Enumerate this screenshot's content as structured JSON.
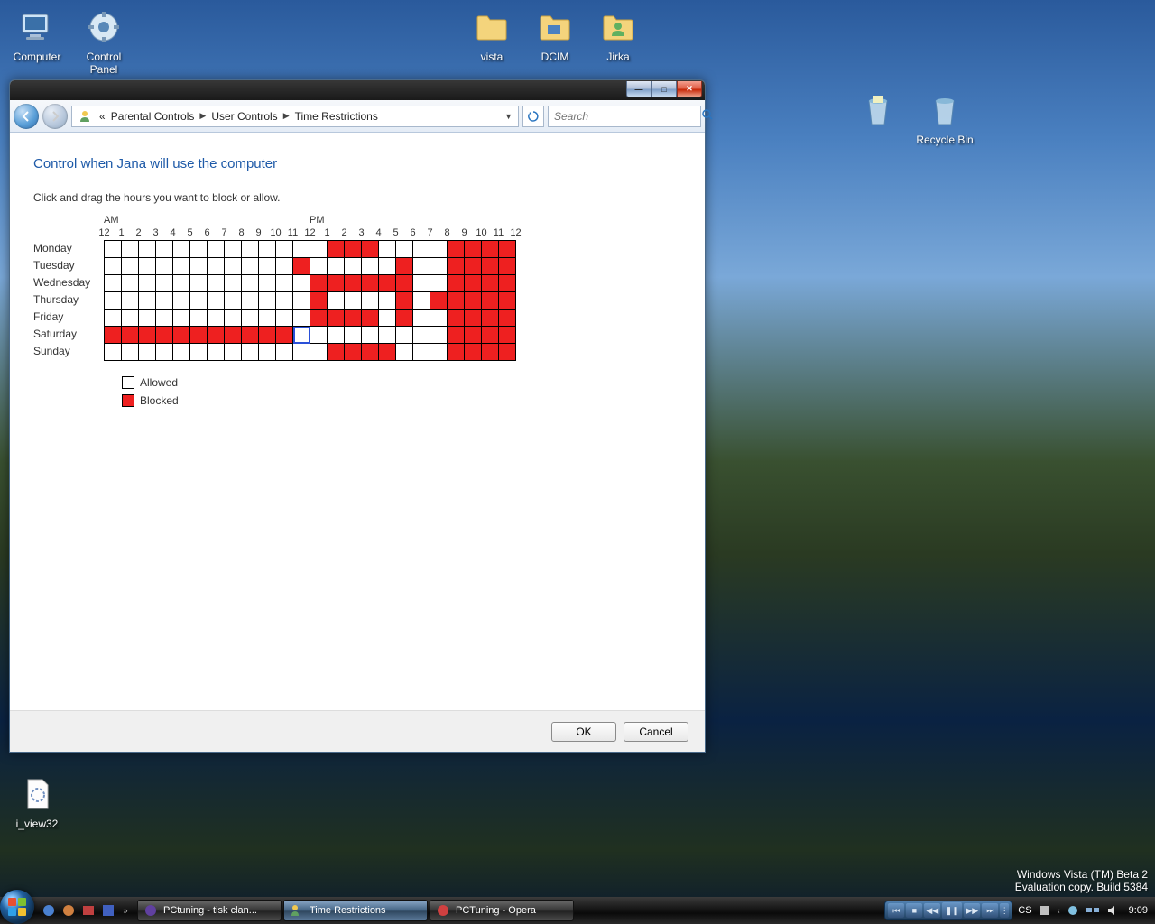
{
  "desktop": {
    "icons": {
      "computer": "Computer",
      "control_panel": "Control Panel",
      "vista": "vista",
      "dcim": "DCIM",
      "jirka": "Jirka",
      "recycle_bin": "Recycle Bin",
      "i_view32": "i_view32"
    }
  },
  "window": {
    "breadcrumb": {
      "prefix": "«",
      "items": [
        "Parental Controls",
        "User Controls",
        "Time Restrictions"
      ]
    },
    "search_placeholder": "Search",
    "heading": "Control when Jana will use the computer",
    "instruction": "Click and drag the hours you want to block or allow.",
    "ampm": {
      "am": "AM",
      "pm": "PM"
    },
    "hours": [
      "12",
      "1",
      "2",
      "3",
      "4",
      "5",
      "6",
      "7",
      "8",
      "9",
      "10",
      "11",
      "12",
      "1",
      "2",
      "3",
      "4",
      "5",
      "6",
      "7",
      "8",
      "9",
      "10",
      "11",
      "12"
    ],
    "days": [
      "Monday",
      "Tuesday",
      "Wednesday",
      "Thursday",
      "Friday",
      "Saturday",
      "Sunday"
    ],
    "schedule": [
      [
        0,
        0,
        0,
        0,
        0,
        0,
        0,
        0,
        0,
        0,
        0,
        0,
        0,
        1,
        1,
        1,
        0,
        0,
        0,
        0,
        1,
        1,
        1,
        1
      ],
      [
        0,
        0,
        0,
        0,
        0,
        0,
        0,
        0,
        0,
        0,
        0,
        1,
        0,
        0,
        0,
        0,
        0,
        1,
        0,
        0,
        1,
        1,
        1,
        1
      ],
      [
        0,
        0,
        0,
        0,
        0,
        0,
        0,
        0,
        0,
        0,
        0,
        0,
        1,
        1,
        1,
        1,
        1,
        1,
        0,
        0,
        1,
        1,
        1,
        1
      ],
      [
        0,
        0,
        0,
        0,
        0,
        0,
        0,
        0,
        0,
        0,
        0,
        0,
        1,
        0,
        0,
        0,
        0,
        1,
        0,
        1,
        1,
        1,
        1,
        1
      ],
      [
        0,
        0,
        0,
        0,
        0,
        0,
        0,
        0,
        0,
        0,
        0,
        0,
        1,
        1,
        1,
        1,
        0,
        1,
        0,
        0,
        1,
        1,
        1,
        1
      ],
      [
        1,
        1,
        1,
        1,
        1,
        1,
        1,
        1,
        1,
        1,
        1,
        0,
        0,
        0,
        0,
        0,
        0,
        0,
        0,
        0,
        1,
        1,
        1,
        1
      ],
      [
        0,
        0,
        0,
        0,
        0,
        0,
        0,
        0,
        0,
        0,
        0,
        0,
        0,
        1,
        1,
        1,
        1,
        0,
        0,
        0,
        1,
        1,
        1,
        1
      ]
    ],
    "selected_cell": {
      "day": 5,
      "hour": 11
    },
    "legend": {
      "allowed": "Allowed",
      "blocked": "Blocked"
    },
    "buttons": {
      "ok": "OK",
      "cancel": "Cancel"
    }
  },
  "watermark": {
    "line1": "Windows Vista (TM) Beta 2",
    "line2": "Evaluation copy. Build 5384"
  },
  "taskbar": {
    "tasks": [
      {
        "label": "PCtuning - tisk clan..."
      },
      {
        "label": "Time Restrictions"
      },
      {
        "label": "PCTuning - Opera"
      }
    ],
    "tray": {
      "lang": "CS",
      "clock": "9:09"
    }
  }
}
